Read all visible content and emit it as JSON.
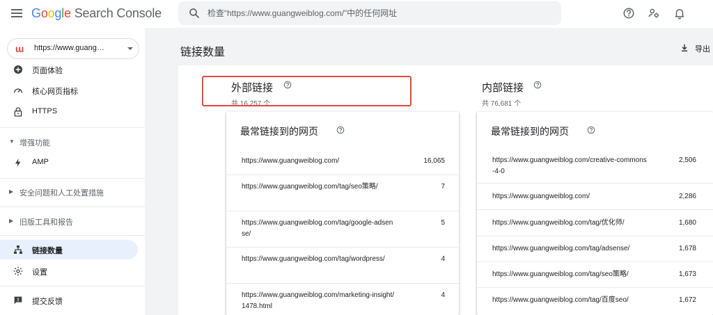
{
  "header": {
    "logo_google": "Google",
    "logo_product": "Search Console",
    "search_placeholder": "检查“https://www.guangweiblog.com/”中的任何网址"
  },
  "sidebar": {
    "property": "https://www.guang…",
    "items_top": [
      {
        "label": "页面体验",
        "icon": "plus-circle-icon"
      },
      {
        "label": "核心网页指标",
        "icon": "gauge-icon"
      },
      {
        "label": "HTTPS",
        "icon": "lock-icon"
      }
    ],
    "group_enhancements": "增强功能",
    "item_amp": "AMP",
    "group_security": "安全问题和人工处置措施",
    "group_legacy": "旧版工具和报告",
    "item_links": "链接数量",
    "item_settings": "设置",
    "item_feedback": "提交反馈"
  },
  "main": {
    "page_title": "链接数量",
    "export_label": "导出",
    "external": {
      "title": "外部链接",
      "total": "共 16,257 个",
      "card_title": "最常链接到的网页",
      "rows": [
        {
          "url": "https://www.guangweiblog.com/",
          "count": "16,065"
        },
        {
          "url": "https://www.guangweiblog.com/tag/seo策略/",
          "count": "7"
        },
        {
          "url": "https://www.guangweiblog.com/tag/google-adsense/",
          "count": "5"
        },
        {
          "url": "https://www.guangweiblog.com/tag/wordpress/",
          "count": "4"
        },
        {
          "url": "https://www.guangweiblog.com/marketing-insight/1478.html",
          "count": "4"
        }
      ]
    },
    "internal": {
      "title": "内部链接",
      "total": "共 76,681 个",
      "card_title": "最常链接到的网页",
      "rows": [
        {
          "url": "https://www.guangweiblog.com/creative-commons-4-0",
          "count": "2,506"
        },
        {
          "url": "https://www.guangweiblog.com/",
          "count": "2,286"
        },
        {
          "url": "https://www.guangweiblog.com/tag/优化师/",
          "count": "1,680"
        },
        {
          "url": "https://www.guangweiblog.com/tag/adsense/",
          "count": "1,678"
        },
        {
          "url": "https://www.guangweiblog.com/tag/seo策略/",
          "count": "1,673"
        },
        {
          "url": "https://www.guangweiblog.com/tag/百度seo/",
          "count": "1,672"
        }
      ]
    }
  },
  "colors": {
    "highlight_border": "#e8453c",
    "active_nav_bg": "#e8f0fe",
    "main_bg": "#f1f3f4"
  }
}
